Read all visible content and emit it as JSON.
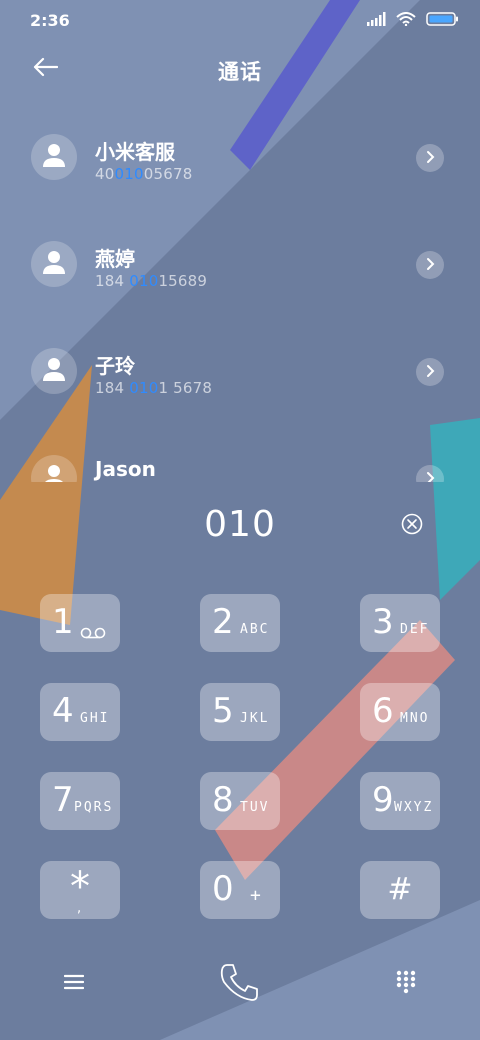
{
  "status_bar": {
    "time": "2:36",
    "icons": [
      "signal-icon",
      "wifi-icon",
      "battery-icon"
    ]
  },
  "header": {
    "back_icon": "back-arrow-icon",
    "title": "通话"
  },
  "results": [
    {
      "name": "小米客服",
      "number_parts": [
        "40",
        "010",
        "05678"
      ]
    },
    {
      "name": "燕婷",
      "number_parts": [
        "184 ",
        "010",
        "15689"
      ]
    },
    {
      "name": "子玲",
      "number_parts": [
        "184 ",
        "010",
        "1 5678"
      ]
    },
    {
      "name": "Jason",
      "number_parts": [
        "",
        "",
        ""
      ]
    }
  ],
  "dialer": {
    "input": "010",
    "clear_icon": "clear-circle-icon"
  },
  "keypad": [
    {
      "digit": "1",
      "letters": "",
      "icon": "voicemail-icon"
    },
    {
      "digit": "2",
      "letters": "ABC"
    },
    {
      "digit": "3",
      "letters": "DEF"
    },
    {
      "digit": "4",
      "letters": "GHI"
    },
    {
      "digit": "5",
      "letters": "JKL"
    },
    {
      "digit": "6",
      "letters": "MNO"
    },
    {
      "digit": "7",
      "letters": "PQRS"
    },
    {
      "digit": "8",
      "letters": "TUV"
    },
    {
      "digit": "9",
      "letters": "WXYZ"
    },
    {
      "digit": "*",
      "letters": ","
    },
    {
      "digit": "0",
      "letters": "+"
    },
    {
      "digit": "#",
      "letters": ""
    }
  ],
  "bottom_bar": {
    "left_icon": "menu-icon",
    "center_icon": "phone-call-icon",
    "right_icon": "keypad-icon"
  },
  "colors": {
    "background": "#7f91b3",
    "highlight": "#2f8bff",
    "key_bg": "rgba(255,255,255,0.33)"
  }
}
